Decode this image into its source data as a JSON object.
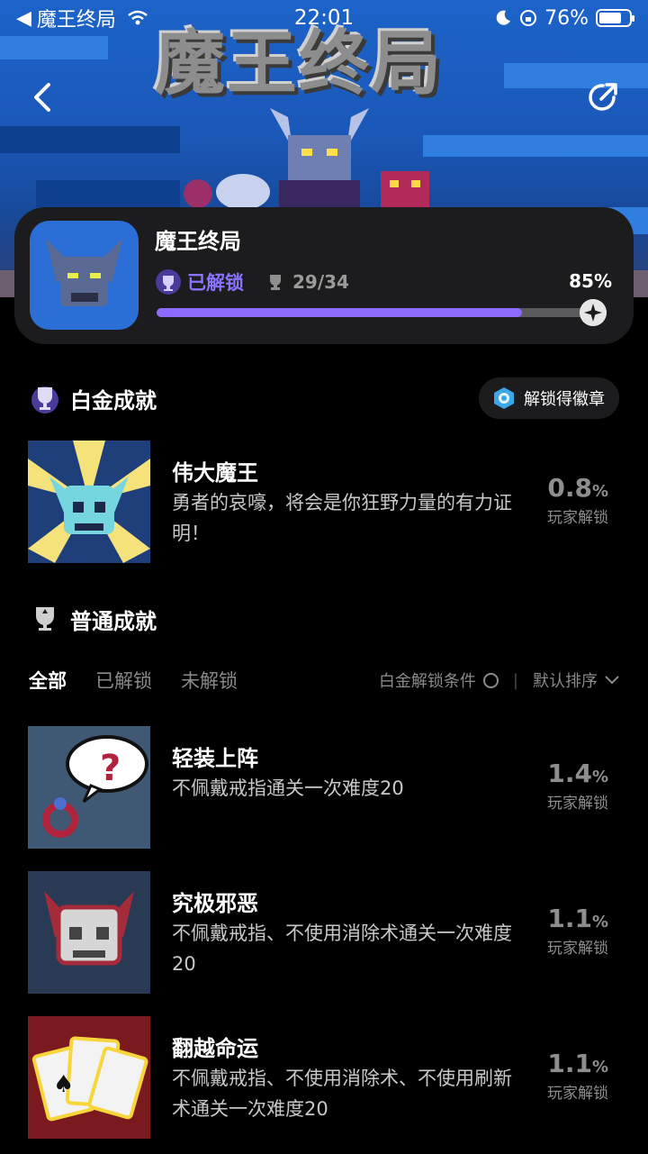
{
  "status_bar": {
    "back_app": "魔王终局",
    "time": "22:01",
    "battery": "76%",
    "battery_level": 0.76
  },
  "banner": {
    "title": "魔王终局"
  },
  "game": {
    "name": "魔王终局",
    "unlocked_label": "已解锁",
    "progress": "29/34",
    "percent": "85%",
    "progress_fraction": 0.85
  },
  "platinum": {
    "title": "白金成就",
    "badge_button": "解锁得徽章",
    "achievement": {
      "name": "伟大魔王",
      "desc": "勇者的哀嚎，将会是你狂野力量的有力证明！",
      "rate": "0.8",
      "unit": "%",
      "rate_label": "玩家解锁"
    }
  },
  "normal": {
    "title": "普通成就",
    "tabs": [
      "全部",
      "已解锁",
      "未解锁"
    ],
    "filter_label": "白金解锁条件",
    "sort_label": "默认排序",
    "achievements": [
      {
        "name": "轻装上阵",
        "desc": "不佩戴戒指通关一次难度20",
        "rate": "1.4",
        "unit": "%",
        "rate_label": "玩家解锁"
      },
      {
        "name": "究极邪恶",
        "desc": "不佩戴戒指、不使用消除术通关一次难度20",
        "rate": "1.1",
        "unit": "%",
        "rate_label": "玩家解锁"
      },
      {
        "name": "翻越命运",
        "desc": "不佩戴戒指、不使用消除术、不使用刷新术通关一次难度20",
        "rate": "1.1",
        "unit": "%",
        "rate_label": "玩家解锁"
      }
    ]
  },
  "colors": {
    "accent": "#8b6cff",
    "card": "#1c1c1e",
    "muted": "#8e8e8e"
  }
}
